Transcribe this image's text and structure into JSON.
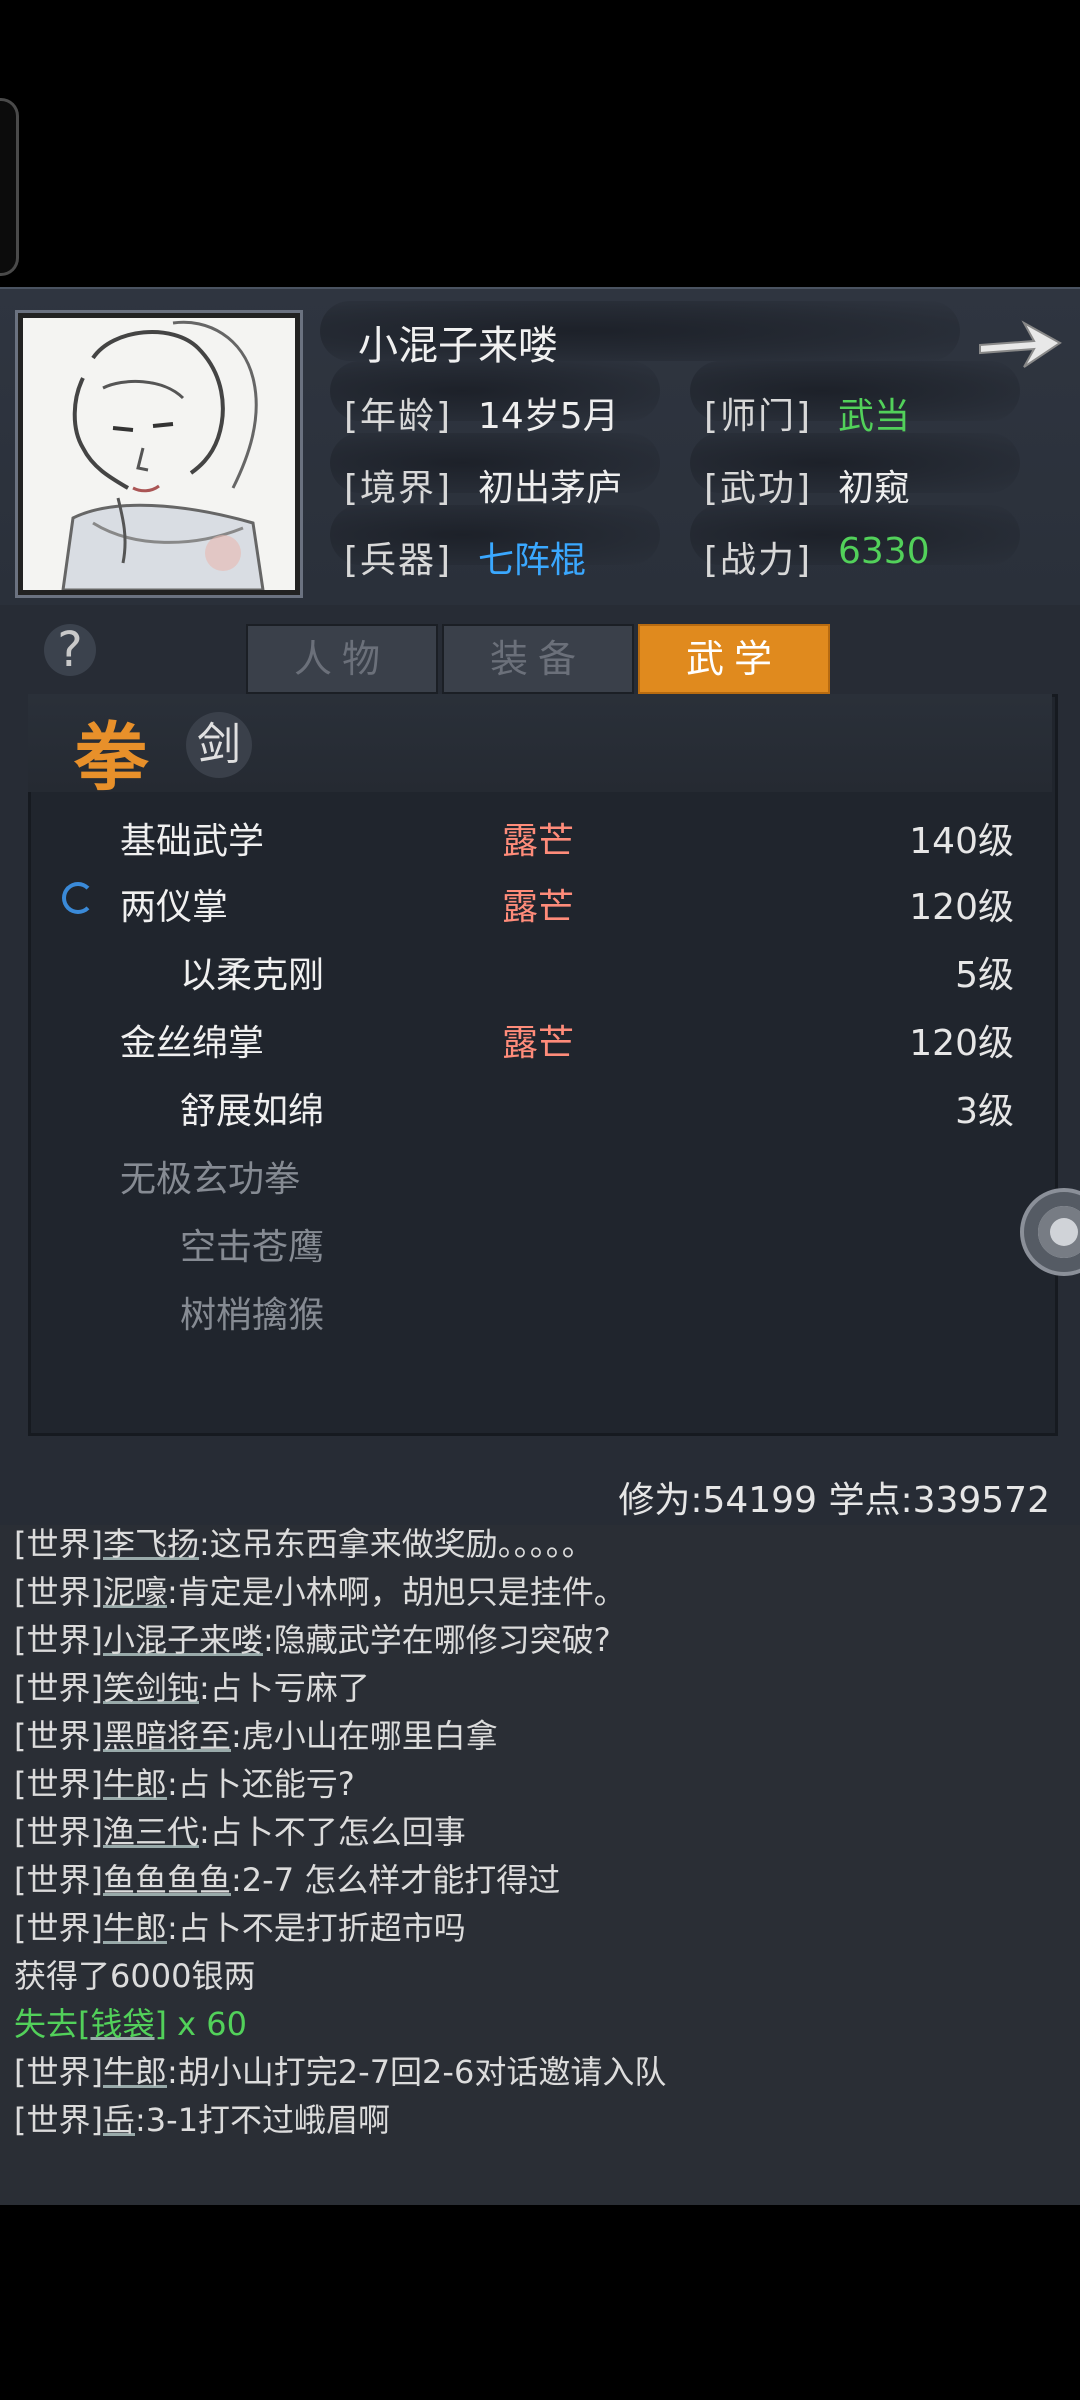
{
  "character": {
    "name": "小混子来喽",
    "rows": [
      {
        "label1": "[年龄]",
        "value1": "14岁5月",
        "label2": "[师门]",
        "value2": "武当"
      },
      {
        "label1": "[境界]",
        "value1": "初出茅庐",
        "label2": "[武功]",
        "value2": "初窥"
      },
      {
        "label1": "[兵器]",
        "value1": "七阵棍",
        "label2": "[战力]",
        "value2": "6330"
      }
    ]
  },
  "help": {
    "label": "?"
  },
  "tabs": [
    {
      "label": "人物",
      "active": false
    },
    {
      "label": "装备",
      "active": false
    },
    {
      "label": "武学",
      "active": true
    }
  ],
  "categories": {
    "fist": "拳",
    "sword": "剑"
  },
  "skills": [
    {
      "name": "基础武学",
      "grade": "露芒",
      "level": "140级"
    },
    {
      "name": "两仪掌",
      "grade": "露芒",
      "level": "120级"
    },
    {
      "name": "以柔克刚",
      "grade": "",
      "level": "5级"
    },
    {
      "name": "金丝绵掌",
      "grade": "露芒",
      "level": "120级"
    },
    {
      "name": "舒展如绵",
      "grade": "",
      "level": "3级"
    },
    {
      "name": "无极玄功拳",
      "grade": "",
      "level": ""
    },
    {
      "name": "空击苍鹰",
      "grade": "",
      "level": ""
    },
    {
      "name": "树梢擒猴",
      "grade": "",
      "level": ""
    }
  ],
  "stats": {
    "text": "修为:54199  学点:339572"
  },
  "chat": [
    {
      "ch": "[世界]",
      "user": "李飞扬",
      "msg": ":这吊东西拿来做奖励。。。。。"
    },
    {
      "ch": "[世界]",
      "user": "泥嚎",
      "msg": ":肯定是小林啊，胡旭只是挂件。"
    },
    {
      "ch": "[世界]",
      "user": "小混子来喽",
      "msg": ":隐藏武学在哪修习突破?"
    },
    {
      "ch": "[世界]",
      "user": "笑剑钝",
      "msg": ":占卜亏麻了"
    },
    {
      "ch": "[世界]",
      "user": "黑暗将至",
      "msg": ":虎小山在哪里白拿"
    },
    {
      "ch": "[世界]",
      "user": "牛郎",
      "msg": ":占卜还能亏?"
    },
    {
      "ch": "[世界]",
      "user": "渔三代",
      "msg": ":占卜不了怎么回事"
    },
    {
      "ch": "[世界]",
      "user": "鱼鱼鱼鱼",
      "msg": ":2-7 怎么样才能打得过"
    },
    {
      "ch": "[世界]",
      "user": "牛郎",
      "msg": ":占卜不是打折超市吗"
    },
    {
      "ch": "",
      "user": "",
      "msg": "获得了6000银两"
    },
    {
      "ch": "",
      "user": "",
      "msg": "失去",
      "item": "[钱袋]",
      "qty": " x 60"
    },
    {
      "ch": "[世界]",
      "user": "牛郎",
      "msg": ":胡小山打完2-7回2-6对话邀请入队"
    },
    {
      "ch": "[世界]",
      "user": "岳",
      "msg": ":3-1打不过峨眉啊"
    }
  ]
}
